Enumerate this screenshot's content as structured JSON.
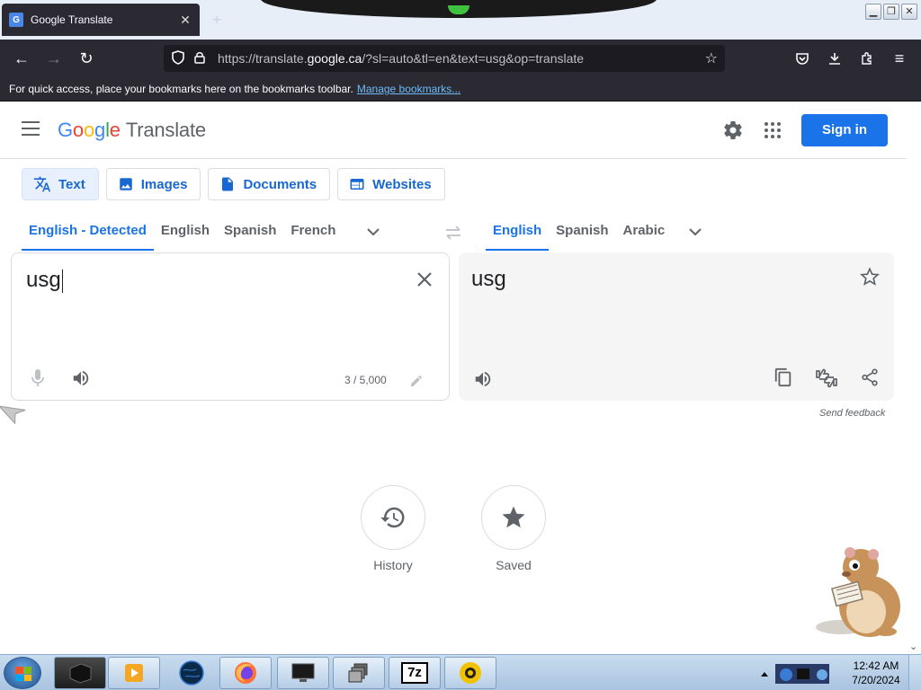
{
  "browser": {
    "tab_title": "Google Translate",
    "url_prefix": "https://translate.",
    "url_domain": "google.ca",
    "url_suffix": "/?sl=auto&tl=en&text=usg&op=translate",
    "bookmarks_message": "For quick access, place your bookmarks here on the bookmarks toolbar.",
    "bookmarks_link": "Manage bookmarks..."
  },
  "header": {
    "logo_letters": [
      "G",
      "o",
      "o",
      "g",
      "l",
      "e"
    ],
    "product": "Translate",
    "signin_label": "Sign in",
    "brand_color": "#1a73e8"
  },
  "modes": [
    {
      "label": "Text",
      "icon": "translate-icon",
      "active": true
    },
    {
      "label": "Images",
      "icon": "image-icon",
      "active": false
    },
    {
      "label": "Documents",
      "icon": "document-icon",
      "active": false
    },
    {
      "label": "Websites",
      "icon": "website-icon",
      "active": false
    }
  ],
  "source_langs": [
    "English - Detected",
    "English",
    "Spanish",
    "French"
  ],
  "target_langs": [
    "English",
    "Spanish",
    "Arabic"
  ],
  "source": {
    "text": "usg",
    "char_count": "3 / 5,000"
  },
  "target": {
    "text": "usg"
  },
  "feedback": "Send feedback",
  "bottom": {
    "history_label": "History",
    "saved_label": "Saved"
  },
  "taskbar": {
    "time": "12:42 AM",
    "date": "7/20/2024",
    "sevenzip_label": "7z"
  }
}
